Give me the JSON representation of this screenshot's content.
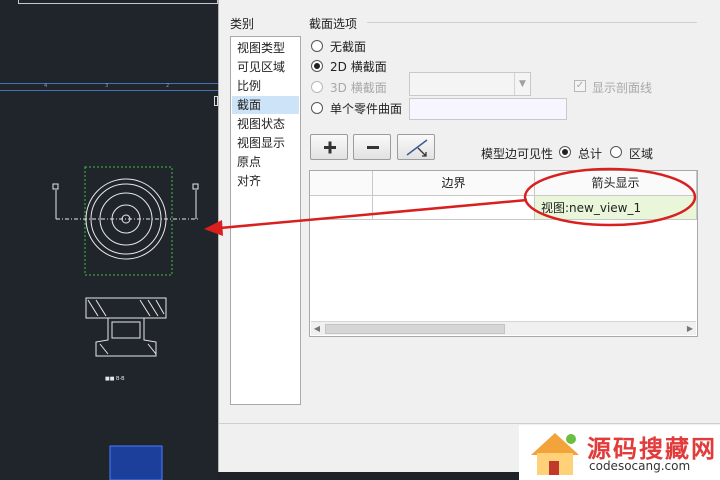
{
  "dialog": {
    "category_heading": "类别",
    "categories": [
      {
        "label": "视图类型",
        "selected": false
      },
      {
        "label": "可见区域",
        "selected": false
      },
      {
        "label": "比例",
        "selected": false
      },
      {
        "label": "截面",
        "selected": true
      },
      {
        "label": "视图状态",
        "selected": false
      },
      {
        "label": "视图显示",
        "selected": false
      },
      {
        "label": "原点",
        "selected": false
      },
      {
        "label": "对齐",
        "selected": false
      }
    ],
    "section_options_heading": "截面选项",
    "radio_no_section": "无截面",
    "radio_2d": "2D 横截面",
    "radio_3d": "3D 横截面",
    "radio_single_part": "单个零件曲面",
    "show_section_lines": "显示剖面线",
    "selected_option": "2D 横截面",
    "model_edge_visibility": "模型边可见性",
    "visibility_total": "总计",
    "visibility_region": "区域",
    "visibility_selected": "总计",
    "table": {
      "columns": [
        "",
        "边界",
        "箭头显示"
      ],
      "rows": [
        [
          "",
          "",
          "视图:new_view_1"
        ]
      ]
    }
  },
  "watermark": {
    "text": "源码搜藏网",
    "url": "codesocang.com"
  },
  "colors": {
    "annotation_red": "#d9201f",
    "highlight_cell": "#e9f6d9",
    "selected_item": "#cde3f7"
  }
}
